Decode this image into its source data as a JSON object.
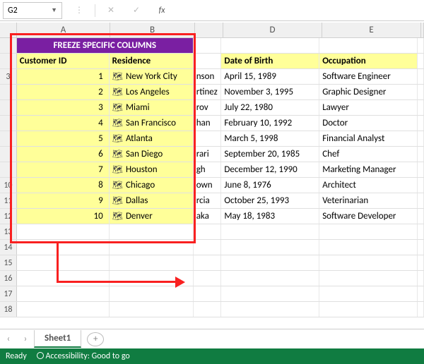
{
  "formula": {
    "cell_ref": "G2",
    "fx_label": "fx"
  },
  "columns": {
    "A": "A",
    "B": "B",
    "D": "D",
    "E": "E"
  },
  "title": "FREEZE SPECIFIC COLUMNS",
  "headers": {
    "customer_id": "Customer ID",
    "residence": "Residence",
    "dob": "Date of Birth",
    "occupation": "Occupation"
  },
  "rows": [
    {
      "n": "3",
      "id": "1",
      "res": "New York City",
      "c_frag": "nson",
      "dob": "April 15, 1989",
      "occ": "Software Engineer"
    },
    {
      "n": "",
      "id": "2",
      "res": "Los Angeles",
      "c_frag": "rtinez",
      "dob": "November 3, 1995",
      "occ": "Graphic Designer"
    },
    {
      "n": "",
      "id": "3",
      "res": "Miami",
      "c_frag": "rov",
      "dob": "July 22, 1980",
      "occ": "Lawyer"
    },
    {
      "n": "",
      "id": "4",
      "res": "San Francisco",
      "c_frag": "han",
      "dob": "February 10, 1992",
      "occ": "Doctor"
    },
    {
      "n": "",
      "id": "5",
      "res": "Atlanta",
      "c_frag": "",
      "dob": "March 5, 1998",
      "occ": "Financial Analyst"
    },
    {
      "n": "",
      "id": "6",
      "res": "San Diego",
      "c_frag": "rari",
      "dob": "September 20, 1985",
      "occ": "Chef"
    },
    {
      "n": "",
      "id": "7",
      "res": "Houston",
      "c_frag": "gh",
      "dob": "December 12, 1990",
      "occ": "Marketing Manager"
    },
    {
      "n": "10",
      "id": "8",
      "res": "Chicago",
      "c_frag": "own",
      "dob": "June 8, 1976",
      "occ": "Architect"
    },
    {
      "n": "11",
      "id": "9",
      "res": "Dallas",
      "c_frag": "rcia",
      "dob": "October 25, 1993",
      "occ": "Veterinarian"
    },
    {
      "n": "12",
      "id": "10",
      "res": "Denver",
      "c_frag": "aka",
      "dob": "May 18, 1983",
      "occ": "Software Developer"
    }
  ],
  "empty_rows": [
    "13",
    "14",
    "15",
    "16",
    "17",
    "18"
  ],
  "sheet": {
    "name": "Sheet1",
    "nav_prev": "‹",
    "nav_next": "›",
    "new": "+"
  },
  "status": {
    "ready": "Ready",
    "access": "Accessibility: Good to go"
  }
}
